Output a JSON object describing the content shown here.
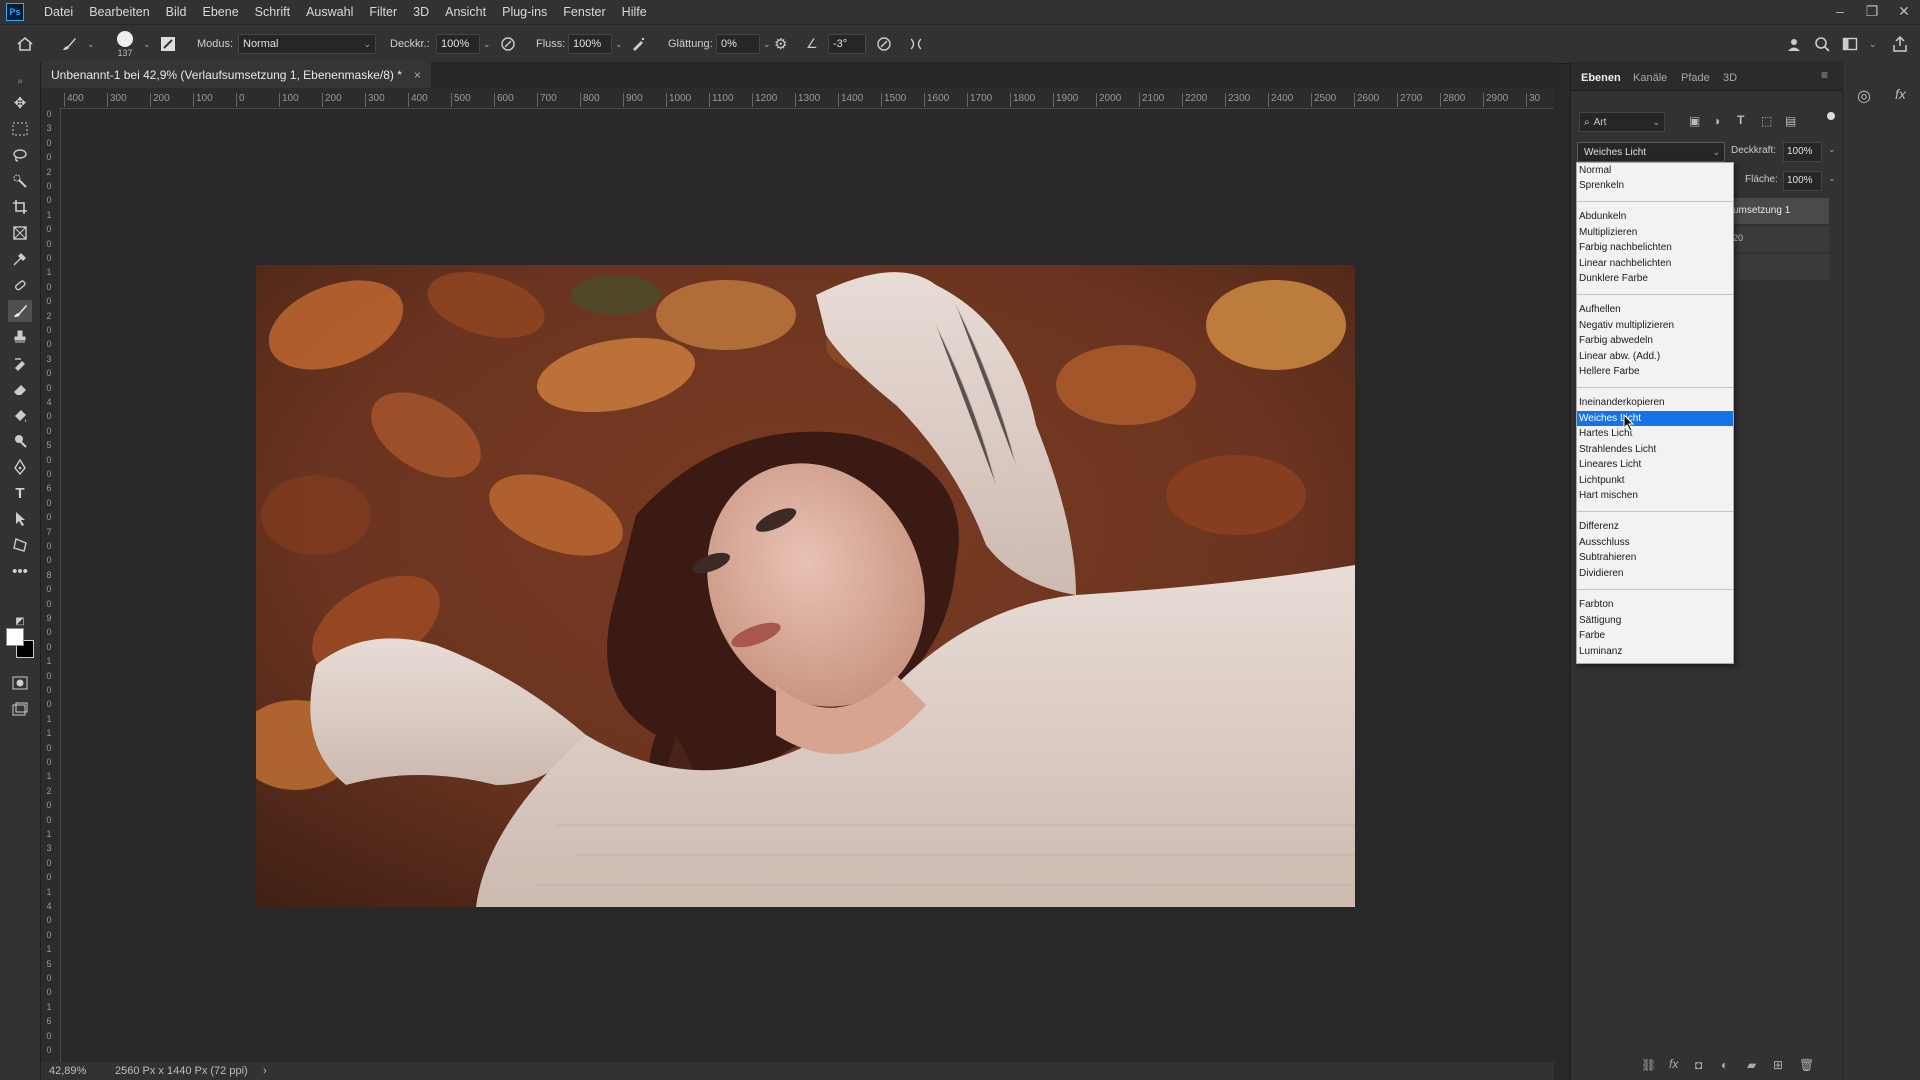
{
  "app": {
    "name": "Ps"
  },
  "menubar": {
    "items": [
      "Datei",
      "Bearbeiten",
      "Bild",
      "Ebene",
      "Schrift",
      "Auswahl",
      "Filter",
      "3D",
      "Ansicht",
      "Plug-ins",
      "Fenster",
      "Hilfe"
    ]
  },
  "options": {
    "brush_size": "137",
    "mode_label": "Modus:",
    "mode_value": "Normal",
    "opacity_label": "Deckkr.:",
    "opacity_value": "100%",
    "flow_label": "Fluss:",
    "flow_value": "100%",
    "smoothing_label": "Glättung:",
    "smoothing_value": "0%",
    "angle_value": "-3°"
  },
  "document": {
    "tab_title": "Unbenannt-1 bei 42,9% (Verlaufsumsetzung 1, Ebenenmaske/8) *",
    "close": "×"
  },
  "ruler": {
    "h_ticks": [
      "400",
      "300",
      "200",
      "100",
      "0",
      "100",
      "200",
      "300",
      "400",
      "500",
      "600",
      "700",
      "800",
      "900",
      "1000",
      "1100",
      "1200",
      "1300",
      "1400",
      "1500",
      "1600",
      "1700",
      "1800",
      "1900",
      "2000",
      "2100",
      "2200",
      "2300",
      "2400",
      "2500",
      "2600",
      "2700",
      "2800",
      "2900",
      "30"
    ],
    "v_ticks": [
      "0",
      "3",
      "0",
      "0",
      "2",
      "0",
      "0",
      "1",
      "0",
      "0",
      "0",
      "1",
      "0",
      "0",
      "2",
      "0",
      "0",
      "3",
      "0",
      "0",
      "4",
      "0",
      "0",
      "5",
      "0",
      "0",
      "6",
      "0",
      "0",
      "7",
      "0",
      "0",
      "8",
      "0",
      "0",
      "9",
      "0",
      "0",
      "1",
      "0",
      "0",
      "0",
      "1",
      "1",
      "0",
      "0",
      "1",
      "2",
      "0",
      "0",
      "1",
      "3",
      "0",
      "0",
      "1",
      "4",
      "0",
      "0",
      "1",
      "5",
      "0",
      "0",
      "1",
      "6",
      "0",
      "0"
    ]
  },
  "status": {
    "zoom": "42,89%",
    "doc_size": "2560 Px x 1440 Px (72 ppi)",
    "arrow": "›"
  },
  "layers_panel": {
    "tabs": [
      "Ebenen",
      "Kanäle",
      "Pfade",
      "3D"
    ],
    "filter_label": "Art",
    "blend_mode": "Weiches Licht",
    "opacity_label": "Deckkraft:",
    "opacity_value": "100%",
    "fill_label": "Fläche:",
    "fill_value": "100%",
    "layer_name_partial": "umsetzung 1",
    "layer_partial2": "20"
  },
  "blend_modes": {
    "selected": "Weiches Licht",
    "groups": [
      [
        "Normal",
        "Sprenkeln"
      ],
      [
        "Abdunkeln",
        "Multiplizieren",
        "Farbig nachbelichten",
        "Linear nachbelichten",
        "Dunklere Farbe"
      ],
      [
        "Aufhellen",
        "Negativ multiplizieren",
        "Farbig abwedeln",
        "Linear abw. (Add.)",
        "Hellere Farbe"
      ],
      [
        "Ineinanderkopieren",
        "Weiches Licht",
        "Hartes Licht",
        "Strahlendes Licht",
        "Lineares Licht",
        "Lichtpunkt",
        "Hart mischen"
      ],
      [
        "Differenz",
        "Ausschluss",
        "Subtrahieren",
        "Dividieren"
      ],
      [
        "Farbton",
        "Sättigung",
        "Farbe",
        "Luminanz"
      ]
    ]
  },
  "colors": {
    "accent": "#1473e6",
    "ui_bg": "#323232",
    "canvas_bg": "#282828"
  }
}
